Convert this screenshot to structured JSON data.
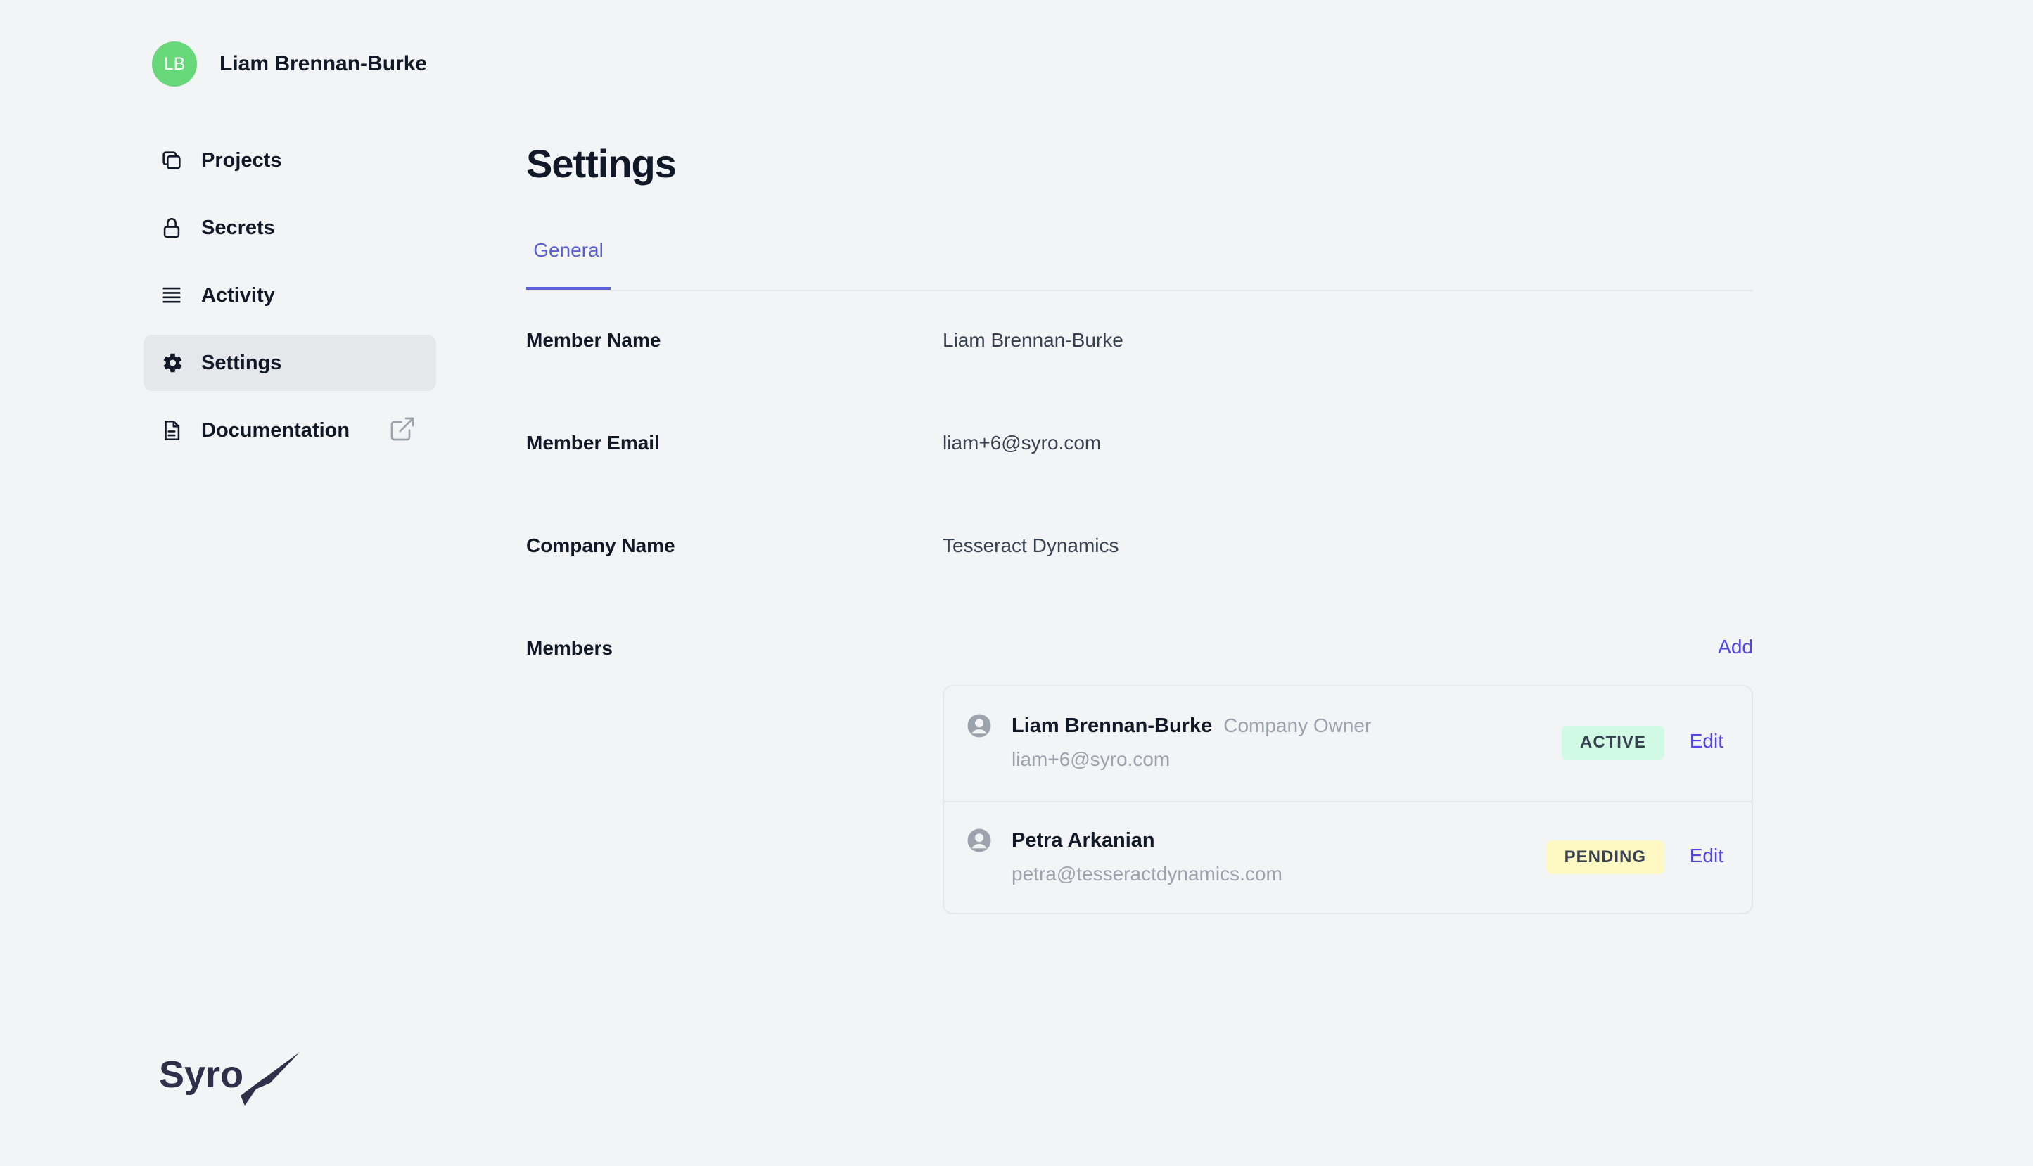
{
  "user": {
    "initials": "LB",
    "name": "Liam Brennan-Burke",
    "avatar_color": "#68d77a"
  },
  "nav": {
    "items": [
      {
        "label": "Projects",
        "icon": "copy-icon"
      },
      {
        "label": "Secrets",
        "icon": "lock-icon"
      },
      {
        "label": "Activity",
        "icon": "list-icon"
      },
      {
        "label": "Settings",
        "icon": "gear-icon",
        "active": true
      },
      {
        "label": "Documentation",
        "icon": "document-icon",
        "external": true
      }
    ]
  },
  "brand": {
    "name": "Syro"
  },
  "page": {
    "title": "Settings",
    "tabs": [
      {
        "label": "General",
        "active": true
      }
    ]
  },
  "fields": {
    "member_name": {
      "label": "Member Name",
      "value": "Liam Brennan-Burke"
    },
    "member_email": {
      "label": "Member Email",
      "value": "liam+6@syro.com"
    },
    "company_name": {
      "label": "Company Name",
      "value": "Tesseract Dynamics"
    }
  },
  "members": {
    "label": "Members",
    "add_label": "Add",
    "list": [
      {
        "name": "Liam Brennan-Burke",
        "role": "Company Owner",
        "email": "liam+6@syro.com",
        "status": "ACTIVE",
        "edit_label": "Edit"
      },
      {
        "name": "Petra Arkanian",
        "role": "",
        "email": "petra@tesseractdynamics.com",
        "status": "PENDING",
        "edit_label": "Edit"
      }
    ]
  },
  "colors": {
    "accent": "#5b5fd6",
    "link": "#4f46e5",
    "active_badge": "#d1fae5",
    "pending_badge": "#fef9c3",
    "background": "#f3f4f6"
  }
}
